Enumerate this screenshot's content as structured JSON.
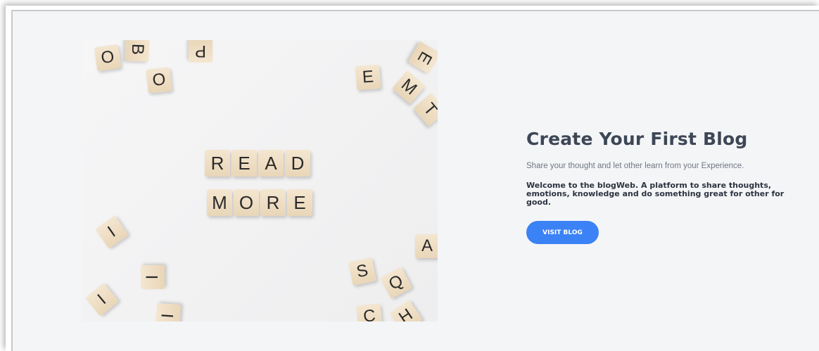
{
  "hero": {
    "word_top": [
      "R",
      "E",
      "A",
      "D"
    ],
    "word_bottom": [
      "M",
      "O",
      "R",
      "E"
    ],
    "scatter": [
      "O",
      "B",
      "P",
      "O",
      "E",
      "E",
      "M",
      "T",
      "I",
      "I",
      "I",
      "A",
      "S",
      "Q",
      "I",
      "C",
      "H"
    ]
  },
  "content": {
    "title": "Create Your First Blog",
    "subtitle": "Share your thought and let other learn from your Experience.",
    "welcome": "Welcome to the blogWeb. A platform to share thoughts, emotions, knowledge and do something great for other for good.",
    "button_label": "VISIT BLOG"
  },
  "colors": {
    "background": "#f4f5f7",
    "title": "#3d4756",
    "button": "#3b82f6"
  }
}
